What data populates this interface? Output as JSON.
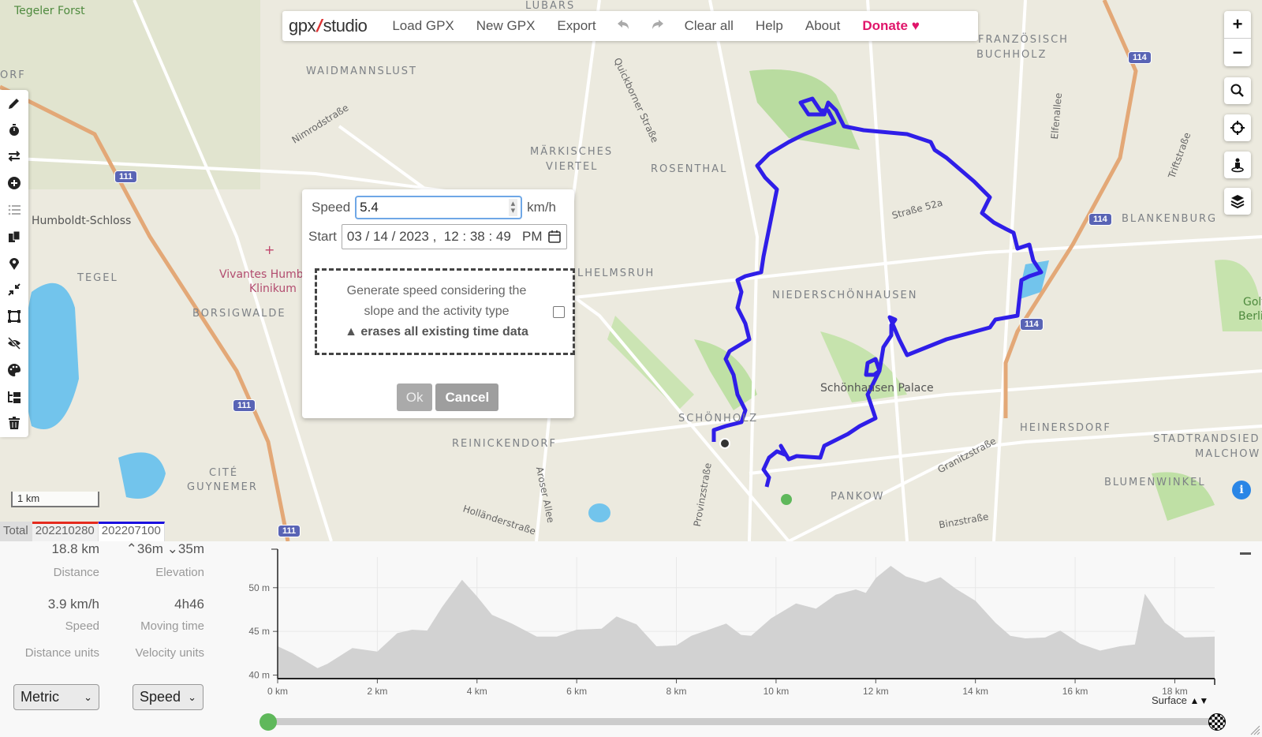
{
  "app": {
    "logo_left": "gpx",
    "logo_right": "studio"
  },
  "menu": {
    "load": "Load GPX",
    "new": "New GPX",
    "export": "Export",
    "undo_icon": "undo-icon",
    "redo_icon": "redo-icon",
    "clear": "Clear all",
    "help": "Help",
    "about": "About",
    "donate": "Donate",
    "donate_icon": "♥",
    "donate_color": "#e0156a"
  },
  "left_tools": [
    {
      "name": "edit-tool",
      "icon": "pencil-icon"
    },
    {
      "name": "time-tool",
      "icon": "stopwatch-icon"
    },
    {
      "name": "reverse-tool",
      "icon": "reverse-arrows-icon"
    },
    {
      "name": "add-tool",
      "icon": "plus-circle-icon"
    },
    {
      "name": "list-tool",
      "icon": "list-icon",
      "disabled": true
    },
    {
      "name": "duplicate-tool",
      "icon": "copy-icon"
    },
    {
      "name": "waypoint-tool",
      "icon": "map-pin-icon"
    },
    {
      "name": "reduce-tool",
      "icon": "compress-icon"
    },
    {
      "name": "crop-tool",
      "icon": "crop-square-icon"
    },
    {
      "name": "hide-tool",
      "icon": "eye-slash-icon"
    },
    {
      "name": "style-tool",
      "icon": "palette-icon"
    },
    {
      "name": "structure-tool",
      "icon": "folder-tree-icon"
    },
    {
      "name": "delete-tool",
      "icon": "trash-icon"
    }
  ],
  "right_controls": {
    "zoom_in": "+",
    "zoom_out": "−",
    "search_icon": "search-icon",
    "locate_icon": "crosshair-icon",
    "streetview_icon": "person-pin-icon",
    "layers_icon": "layers-icon",
    "info": "i"
  },
  "dialog": {
    "speed_label": "Speed",
    "speed_value": "5.4",
    "speed_unit": "km/h",
    "start_label": "Start",
    "start_value": "03 / 14 / 2023 ,  12 : 38 : 49   PM",
    "generate_line1": "Generate speed considering the",
    "generate_line2": "slope and the activity type",
    "warning": "erases all existing time data",
    "generate_checked": false,
    "ok": "Ok",
    "cancel": "Cancel"
  },
  "map": {
    "scale": "1 km",
    "labels": {
      "tegeler_forst": "Tegeler Forst",
      "orf": "ORF",
      "lubars": "LÜBARS",
      "waidmannslust": "WAIDMANNSLUST",
      "nimrodstrasse": "Nimrodstraße",
      "quickborner": "Quickborner Straße",
      "markisches": "MÄRKISCHES",
      "viertel": "VIERTEL",
      "rosenthal": "ROSENTHAL",
      "franzoesisch": "FRANZÖSISCH",
      "buchholz": "BUCHHOLZ",
      "elfenallee": "Elfenallee",
      "triftstrasse": "Triftstraße",
      "strasse52a": "Straße 52a",
      "blankenburg": "BLANKENBURG",
      "humboldt": "Humboldt-Schloss",
      "tegel": "TEGEL",
      "vivantes1": "Vivantes Humb",
      "vivantes2": "Klinikum",
      "borsigwalde": "BORSIGWALDE",
      "wilhelmsruh": "LHELMSRUH",
      "niederschoenhausen": "NIEDERSCHÖNHAUSEN",
      "golf1": "Golf",
      "golf2": "Berlin",
      "schoenhausen": "Schönhausen Palace",
      "schoenholz": "SCHÖNHOLZ",
      "heinersdorf": "HEINERSDORF",
      "stadtrand1": "STADTRANDSIED",
      "stadtrand2": "MALCHOW",
      "reinickendorf": "REINICKENDORF",
      "cite": "CITÉ",
      "guynemer": "GUYNEMER",
      "aroser": "Aroser Allee",
      "provinz": "Provinzstraße",
      "granitz": "Granitzstraße",
      "pankow": "PANKOW",
      "blumenwinkel": "BLUMENWINKEL",
      "binz": "Binzstraße",
      "hollaender": "Holländerstraße"
    },
    "shields": [
      "111",
      "111",
      "111",
      "114",
      "114",
      "114",
      "111"
    ],
    "track_color": "#2f1ee8"
  },
  "tabs": [
    {
      "label": "Total"
    },
    {
      "label": "202210280",
      "color": "#e52b1e"
    },
    {
      "label": "202207100",
      "color": "#1a10e0"
    }
  ],
  "stats": {
    "distance_value": "18.8 km",
    "distance_label": "Distance",
    "elev_up": "36m",
    "elev_down": "35m",
    "elevation_label": "Elevation",
    "speed_value": "3.9 km/h",
    "speed_label": "Speed",
    "moving_value": "4h46",
    "moving_label": "Moving time",
    "distance_units_label": "Distance units",
    "distance_units_value": "Metric",
    "velocity_units_label": "Velocity units",
    "velocity_units_value": "Speed"
  },
  "surface_label": "Surface",
  "chart_data": {
    "type": "area",
    "title": "",
    "xlabel": "",
    "ylabel": "",
    "x_unit": "km",
    "y_unit": "m",
    "xlim": [
      0,
      18.8
    ],
    "ylim": [
      39.6,
      53.5
    ],
    "x_ticks": [
      "0 km",
      "2 km",
      "4 km",
      "6 km",
      "8 km",
      "10 km",
      "12 km",
      "14 km",
      "16 km",
      "18 km"
    ],
    "y_ticks": [
      "40 m",
      "45 m",
      "50 m"
    ],
    "x_tick_values": [
      0,
      2,
      4,
      6,
      8,
      10,
      12,
      14,
      16,
      18
    ],
    "y_tick_values": [
      40,
      45,
      50
    ],
    "grid": true,
    "fill_color": "#d2d2d2",
    "x": [
      0,
      0.3,
      0.8,
      1.0,
      1.5,
      2.0,
      2.4,
      2.7,
      3.0,
      3.3,
      3.7,
      4.0,
      4.3,
      4.7,
      5.2,
      5.6,
      6.0,
      6.5,
      6.8,
      7.2,
      7.6,
      8.0,
      8.3,
      8.6,
      9.0,
      9.3,
      9.5,
      9.9,
      10.4,
      10.8,
      11.2,
      11.6,
      11.8,
      12.0,
      12.3,
      12.6,
      13.0,
      13.3,
      13.6,
      14.0,
      14.4,
      14.7,
      15.0,
      15.4,
      15.7,
      16.1,
      16.5,
      16.9,
      17.2,
      17.4,
      17.8,
      18.2,
      18.8
    ],
    "y": [
      43.3,
      42.5,
      40.8,
      41.3,
      43.1,
      42.7,
      44.8,
      45.2,
      45.1,
      47.8,
      50.9,
      49.0,
      46.9,
      45.9,
      44.4,
      44.4,
      45.2,
      45.3,
      46.7,
      45.8,
      43.3,
      43.4,
      44.5,
      45.1,
      45.9,
      44.6,
      44.5,
      46.5,
      48.2,
      47.6,
      49.2,
      49.8,
      49.4,
      51.1,
      52.5,
      51.3,
      50.6,
      51.2,
      49.9,
      48.5,
      46.0,
      44.5,
      44.2,
      44.3,
      45.1,
      43.6,
      42.8,
      43.3,
      43.5,
      49.3,
      46.0,
      44.3,
      44.4
    ]
  }
}
